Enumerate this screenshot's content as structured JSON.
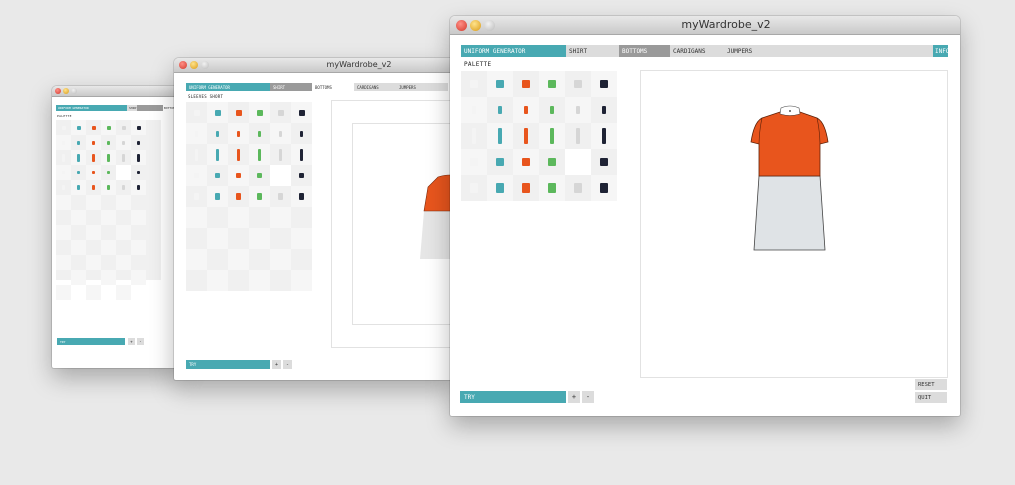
{
  "app": {
    "window_title": "myWardrobe_v2",
    "tabs": [
      "UNIFORM GENERATOR",
      "SHIRT",
      "BOTTOMS",
      "CARDIGANS",
      "JUMPERS",
      "INFO"
    ],
    "palette_label": "PALETTE",
    "sub_label": "SLEEVES SHORT",
    "try_label": "TRY",
    "plus_label": "+",
    "minus_label": "-",
    "reset_label": "RESET",
    "quit_label": "QUIT"
  },
  "colors": {
    "accent": "#48a9b2",
    "orange": "#e8551d",
    "green": "#5cb85c",
    "navy": "#1f2335",
    "light": "#d6d6d6",
    "skirt": "#dfe3e6",
    "white_item": "#f4f4f4"
  },
  "palette_colors": [
    "white_item",
    "accent",
    "orange",
    "green",
    "light",
    "navy"
  ],
  "palette_rows": [
    {
      "kind": "tee",
      "slots": [
        0,
        1,
        2,
        3,
        4,
        5
      ]
    },
    {
      "kind": "shorts",
      "slots": [
        0,
        1,
        2,
        3,
        4,
        5
      ]
    },
    {
      "kind": "trousers",
      "slots": [
        0,
        1,
        2,
        3,
        4,
        5
      ]
    },
    {
      "kind": "square",
      "slots": [
        0,
        1,
        2,
        3,
        -1,
        5
      ]
    },
    {
      "kind": "skirt",
      "slots": [
        0,
        1,
        2,
        3,
        4,
        5
      ]
    }
  ],
  "outfit": {
    "top": "orange",
    "bottom": "skirt"
  }
}
